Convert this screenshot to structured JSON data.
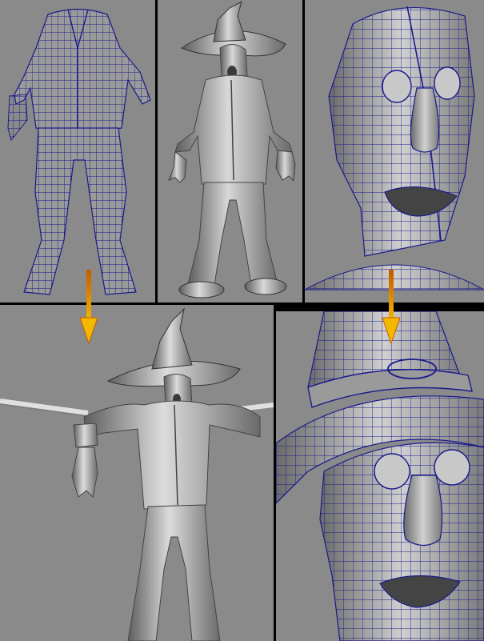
{
  "figure": {
    "panels": [
      {
        "id": "p1",
        "subject": "wireframe-suit-body"
      },
      {
        "id": "p2",
        "subject": "shaded-scarecrow-standing"
      },
      {
        "id": "p3",
        "subject": "wireframe-head-closeup"
      },
      {
        "id": "p4",
        "subject": "shaded-scarecrow-arms-out"
      },
      {
        "id": "p5",
        "subject": "wireframe-hat-head-closeup"
      }
    ],
    "arrows": [
      {
        "from": "p1",
        "to": "p4",
        "color": "#f5b800"
      },
      {
        "from": "p3",
        "to": "p5",
        "color": "#f5b800"
      }
    ],
    "colors": {
      "background_gray": "#8a8a8a",
      "wire_blue": "#1a1a8c",
      "mesh_gray": "#b8b8b8",
      "divider": "#000000",
      "arrow_yellow": "#f5b800"
    }
  }
}
